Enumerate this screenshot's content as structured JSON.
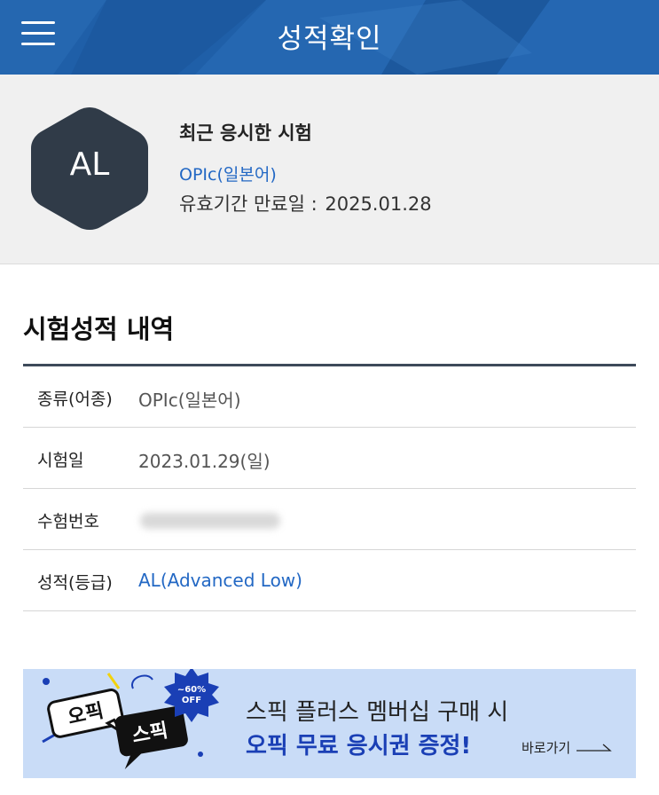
{
  "header": {
    "title": "성적확인",
    "menu_icon": "hamburger-menu-icon",
    "bg_color": "#1f5fa8"
  },
  "profile": {
    "grade": "AL",
    "recent_label": "최근 응시한 시험",
    "recent_exam": "OPIc(일본어)",
    "expiry_label": "유효기간 만료일 :",
    "expiry_date": "2025.01.28",
    "badge_color": "#303b48"
  },
  "section": {
    "title": "시험성적 내역"
  },
  "rows": [
    {
      "label": "종류(어종)",
      "value": "OPIc(일본어)"
    },
    {
      "label": "시험일",
      "value": "2023.01.29(일)"
    },
    {
      "label": "수험번호",
      "value": ""
    },
    {
      "label": "성적(등급)",
      "value": "AL(Advanced Low)"
    }
  ],
  "banner": {
    "line1": "스픽 플러스 멤버십 구매 시",
    "line2": "오픽 무료 응시권 증정!",
    "go_label": "바로가기",
    "badge_top": "~60%",
    "badge_bottom": "OFF",
    "tag1": "오픽",
    "tag2": "스픽",
    "bg_color": "#c9dcf7"
  }
}
